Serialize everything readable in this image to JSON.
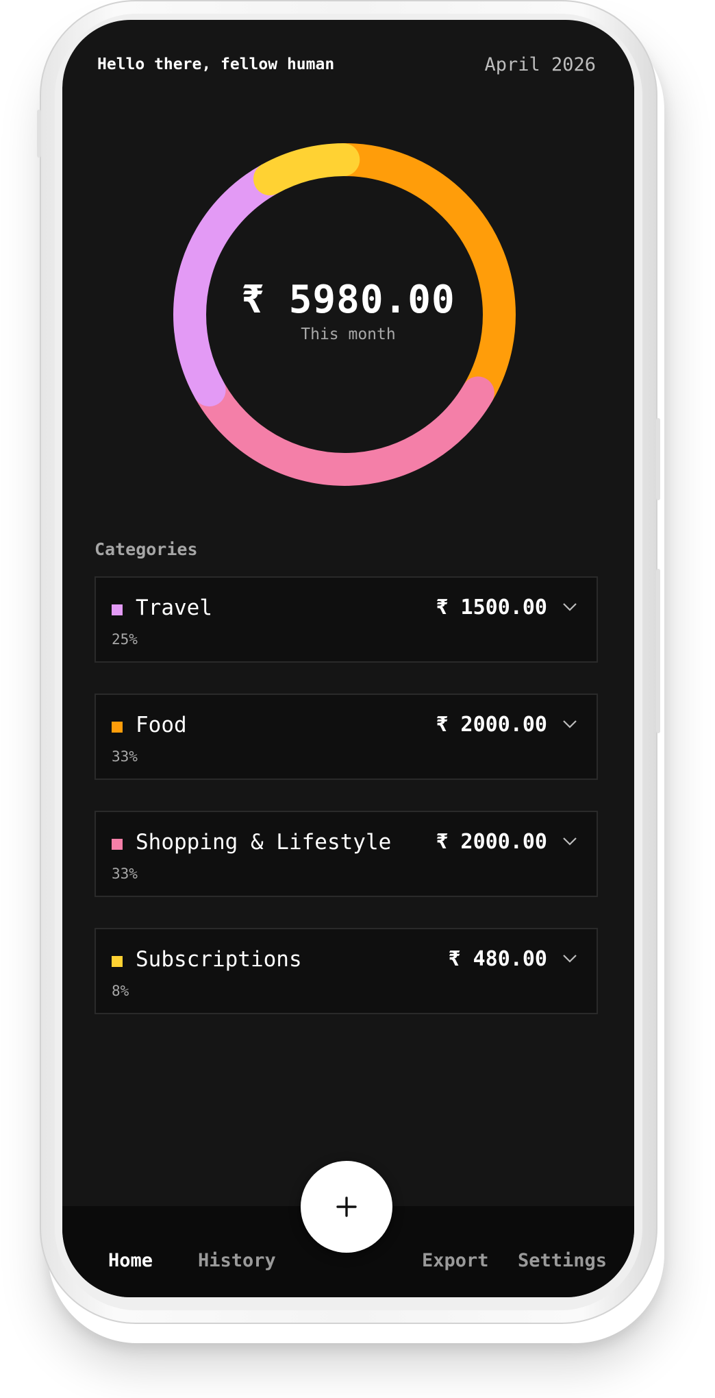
{
  "header": {
    "greeting": "Hello there, fellow human",
    "month": "April 2026"
  },
  "summary": {
    "total": "₹ 5980.00",
    "caption": "This month"
  },
  "categories_title": "Categories",
  "categories": [
    {
      "name": "Travel",
      "percent": "25%",
      "amount": "₹ 1500.00",
      "color": "#e39af5"
    },
    {
      "name": "Food",
      "percent": "33%",
      "amount": "₹ 2000.00",
      "color": "#ff9d0a"
    },
    {
      "name": "Shopping & Lifestyle",
      "percent": "33%",
      "amount": "₹ 2000.00",
      "color": "#f47fa8"
    },
    {
      "name": "Subscriptions",
      "percent": "8%",
      "amount": "₹ 480.00",
      "color": "#ffd233"
    }
  ],
  "chart_data": {
    "type": "pie",
    "categories": [
      "Travel",
      "Food",
      "Shopping & Lifestyle",
      "Subscriptions"
    ],
    "values": [
      1500,
      2000,
      2000,
      480
    ],
    "colors": [
      "#e39af5",
      "#ff9d0a",
      "#f47fa8",
      "#ffd233"
    ]
  },
  "nav": {
    "home": "Home",
    "history": "History",
    "export": "Export",
    "settings": "Settings",
    "add_icon": "plus-icon"
  }
}
